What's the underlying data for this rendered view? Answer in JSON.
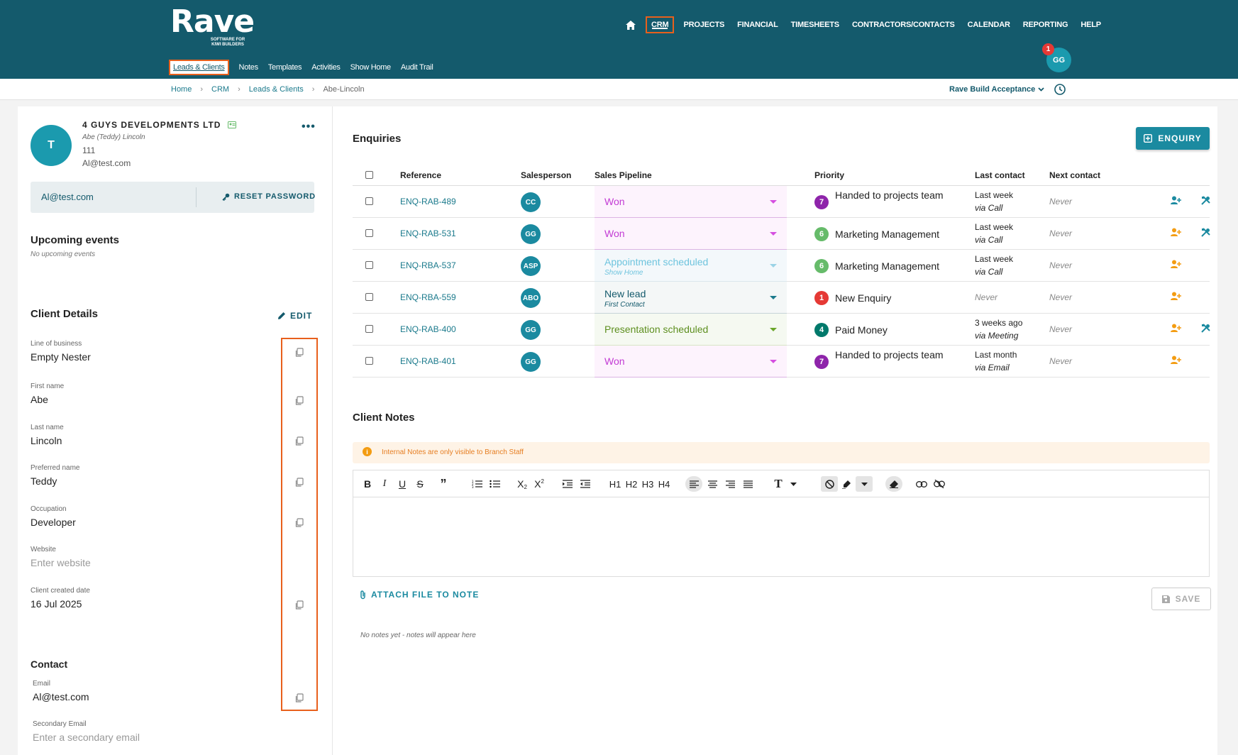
{
  "brand": {
    "name": "Rave",
    "tagline_line1": "SOFTWARE FOR",
    "tagline_line2": "KIWI BUILDERS"
  },
  "nav": {
    "items": [
      "CRM",
      "PROJECTS",
      "FINANCIAL",
      "TIMESHEETS",
      "CONTRACTORS/CONTACTS",
      "CALENDAR",
      "REPORTING",
      "HELP"
    ],
    "active": "CRM"
  },
  "subnav": {
    "items": [
      "Leads & Clients",
      "Notes",
      "Templates",
      "Activities",
      "Show Home",
      "Audit Trail"
    ],
    "active": "Leads & Clients"
  },
  "user": {
    "initials": "GG",
    "notifications": "1"
  },
  "breadcrumb": [
    "Home",
    "CRM",
    "Leads & Clients",
    "Abe-Lincoln"
  ],
  "company_selector": "Rave Build Acceptance",
  "client": {
    "avatar_initial": "T",
    "company": "4 GUYS DEVELOPMENTS LTD",
    "contact_name": "Abe (Teddy) Lincoln",
    "phone": "111",
    "email": "Al@test.com",
    "login_email": "Al@test.com",
    "reset_password_label": "RESET PASSWORD"
  },
  "upcoming": {
    "title": "Upcoming events",
    "empty": "No upcoming events"
  },
  "details": {
    "title": "Client Details",
    "edit_label": "EDIT",
    "fields": [
      {
        "label": "Line of business",
        "value": "Empty Nester"
      },
      {
        "label": "First name",
        "value": "Abe"
      },
      {
        "label": "Last name",
        "value": "Lincoln"
      },
      {
        "label": "Preferred name",
        "value": "Teddy"
      },
      {
        "label": "Occupation",
        "value": "Developer"
      },
      {
        "label": "Website",
        "placeholder": "Enter website"
      },
      {
        "label": "Client created date",
        "value": "16 Jul 2025"
      }
    ]
  },
  "contact": {
    "title": "Contact",
    "email_label": "Email",
    "email_value": "Al@test.com",
    "secondary_label": "Secondary Email",
    "secondary_placeholder": "Enter a secondary email"
  },
  "enquiries": {
    "title": "Enquiries",
    "add_label": "ENQUIRY",
    "columns": [
      "Reference",
      "Salesperson",
      "Sales Pipeline",
      "Priority",
      "Last contact",
      "Next contact"
    ],
    "rows": [
      {
        "ref": "ENQ-RAB-489",
        "sp": "CC",
        "pipeline": "Won",
        "pipeline_sub": "",
        "prio": "7",
        "prio_color": "#8e24aa",
        "prio_text": "Handed to projects team",
        "lc_when": "Last week",
        "lc_via": "via Call",
        "next": "Never",
        "icon1": "assign-icon",
        "icon1_color": "#1b8aa0",
        "icon2": true
      },
      {
        "ref": "ENQ-RAB-531",
        "sp": "GG",
        "pipeline": "Won",
        "pipeline_sub": "",
        "prio": "6",
        "prio_color": "#66bb6a",
        "prio_text": "Marketing Management",
        "lc_when": "Last week",
        "lc_via": "via Call",
        "next": "Never",
        "icon1": "add-user-icon",
        "icon1_color": "#f39c12",
        "icon2": true
      },
      {
        "ref": "ENQ-RBA-537",
        "sp": "ASP",
        "pipeline": "Appointment scheduled",
        "pipeline_sub": "Show Home",
        "prio": "6",
        "prio_color": "#66bb6a",
        "prio_text": "Marketing Management",
        "lc_when": "Last week",
        "lc_via": "via Call",
        "next": "Never",
        "icon1": "add-user-icon",
        "icon1_color": "#f39c12",
        "icon2": false
      },
      {
        "ref": "ENQ-RBA-559",
        "sp": "ABO",
        "pipeline": "New lead",
        "pipeline_sub": "First Contact",
        "prio": "1",
        "prio_color": "#e53935",
        "prio_text": "New Enquiry",
        "lc_when": "",
        "lc_via": "",
        "lc_never": "Never",
        "next": "Never",
        "icon1": "add-user-icon",
        "icon1_color": "#f39c12",
        "icon2": false
      },
      {
        "ref": "ENQ-RAB-400",
        "sp": "GG",
        "pipeline": "Presentation scheduled",
        "pipeline_sub": "",
        "prio": "4",
        "prio_color": "#00796b",
        "prio_text": "Paid Money",
        "lc_when": "3 weeks ago",
        "lc_via": "via Meeting",
        "next": "Never",
        "icon1": "add-user-icon",
        "icon1_color": "#f39c12",
        "icon2": true
      },
      {
        "ref": "ENQ-RAB-401",
        "sp": "GG",
        "pipeline": "Won",
        "pipeline_sub": "",
        "prio": "7",
        "prio_color": "#8e24aa",
        "prio_text": "Handed to projects team",
        "lc_when": "Last month",
        "lc_via": "via Email",
        "next": "Never",
        "icon1": "add-user-icon",
        "icon1_color": "#f39c12",
        "icon2": false
      }
    ]
  },
  "notes": {
    "title": "Client Notes",
    "notice": "Internal Notes are only visible to Branch Staff",
    "attach_label": "ATTACH FILE TO NOTE",
    "save_label": "SAVE",
    "empty": "No notes yet - notes will appear here",
    "toolbar_headings": [
      "H1",
      "H2",
      "H3",
      "H4"
    ]
  }
}
